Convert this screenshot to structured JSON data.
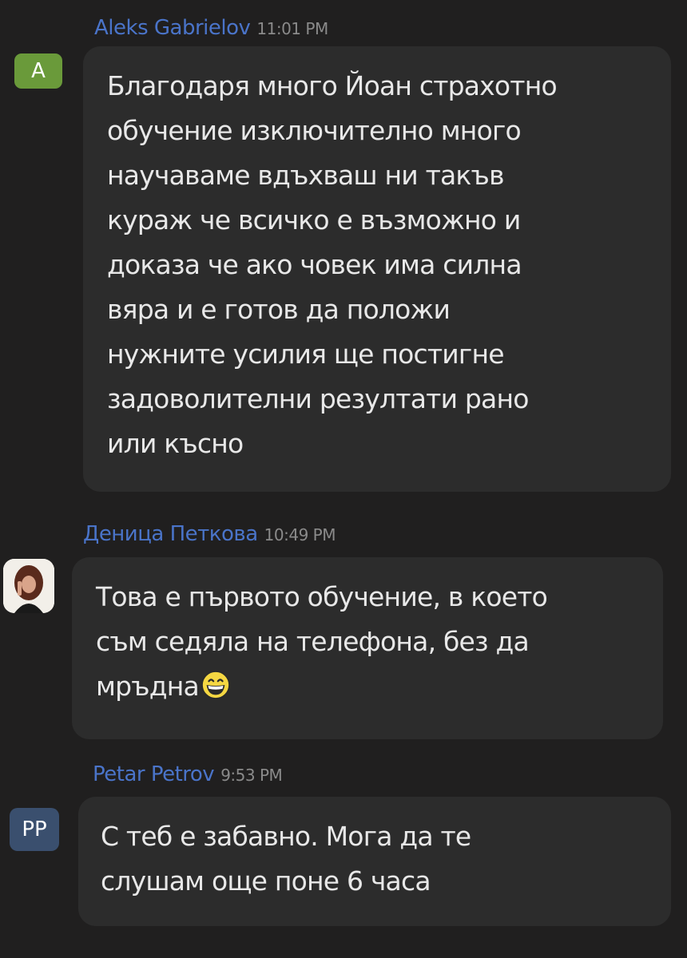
{
  "messages": [
    {
      "sender": "Aleks Gabrielov",
      "time": "11:01 PM",
      "avatar": {
        "type": "initials",
        "text": "A",
        "color": "#6a9a3a"
      },
      "text": "Благодаря много Йоан страхотно\nобучение изключително много\nнаучаваме вдъхваш ни такъв\nкураж че всичко е възможно и\nдоказа че ако човек има силна\nвяра и е готов да положи\nнужните усилия ще постигне\nзадоволителни резултати рано\nили късно"
    },
    {
      "sender": "Деница Петкова",
      "time": "10:49 PM",
      "avatar": {
        "type": "photo",
        "icon": "profile-photo"
      },
      "text": "Това е първото обучение, в което\nсъм седяла на телефона, без да\nмръдна",
      "emoji": "grinning-face-emoji"
    },
    {
      "sender": "Petar Petrov",
      "time": "9:53 PM",
      "avatar": {
        "type": "initials",
        "text": "PP",
        "color": "#3a4f6e"
      },
      "text": "С теб е забавно. Мога да те\nслушам още поне 6 часа"
    }
  ],
  "colors": {
    "background": "#201f1f",
    "bubble": "#2c2c2c",
    "sender": "#4a74c9",
    "timestamp": "#8a8a8a",
    "message_text": "#e8e8e8"
  }
}
